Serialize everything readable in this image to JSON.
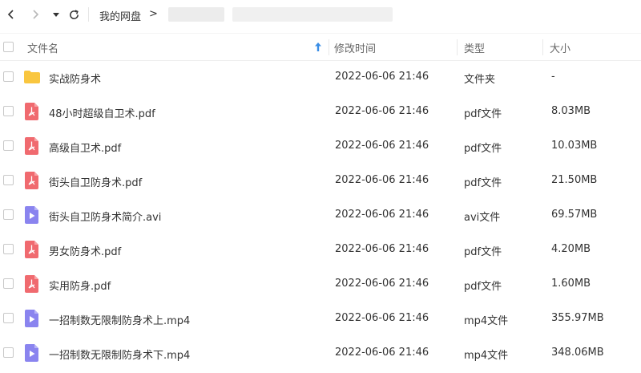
{
  "toolbar": {
    "breadcrumb_root": "我的网盘",
    "breadcrumb_separator": ">"
  },
  "header": {
    "name": "文件名",
    "modified": "修改时间",
    "type": "类型",
    "size": "大小"
  },
  "files": [
    {
      "name": "实战防身术",
      "modified": "2022-06-06 21:46",
      "type": "文件夹",
      "size": "-",
      "icon": "folder-icon"
    },
    {
      "name": "48小时超级自卫术.pdf",
      "modified": "2022-06-06 21:46",
      "type": "pdf文件",
      "size": "8.03MB",
      "icon": "pdf-icon"
    },
    {
      "name": "高级自卫术.pdf",
      "modified": "2022-06-06 21:46",
      "type": "pdf文件",
      "size": "10.03MB",
      "icon": "pdf-icon"
    },
    {
      "name": "街头自卫防身术.pdf",
      "modified": "2022-06-06 21:46",
      "type": "pdf文件",
      "size": "21.50MB",
      "icon": "pdf-icon"
    },
    {
      "name": "街头自卫防身术简介.avi",
      "modified": "2022-06-06 21:46",
      "type": "avi文件",
      "size": "69.57MB",
      "icon": "video-icon"
    },
    {
      "name": "男女防身术.pdf",
      "modified": "2022-06-06 21:46",
      "type": "pdf文件",
      "size": "4.20MB",
      "icon": "pdf-icon"
    },
    {
      "name": "实用防身.pdf",
      "modified": "2022-06-06 21:46",
      "type": "pdf文件",
      "size": "1.60MB",
      "icon": "pdf-icon"
    },
    {
      "name": "一招制数无限制防身术上.mp4",
      "modified": "2022-06-06 21:46",
      "type": "mp4文件",
      "size": "355.97MB",
      "icon": "video-icon"
    },
    {
      "name": "一招制数无限制防身术下.mp4",
      "modified": "2022-06-06 21:46",
      "type": "mp4文件",
      "size": "348.06MB",
      "icon": "video-icon"
    }
  ],
  "colors": {
    "folder": "#f9c63f",
    "pdf": "#f06a6f",
    "video": "#8a84ef",
    "sort_arrow": "#3a8ee6"
  }
}
